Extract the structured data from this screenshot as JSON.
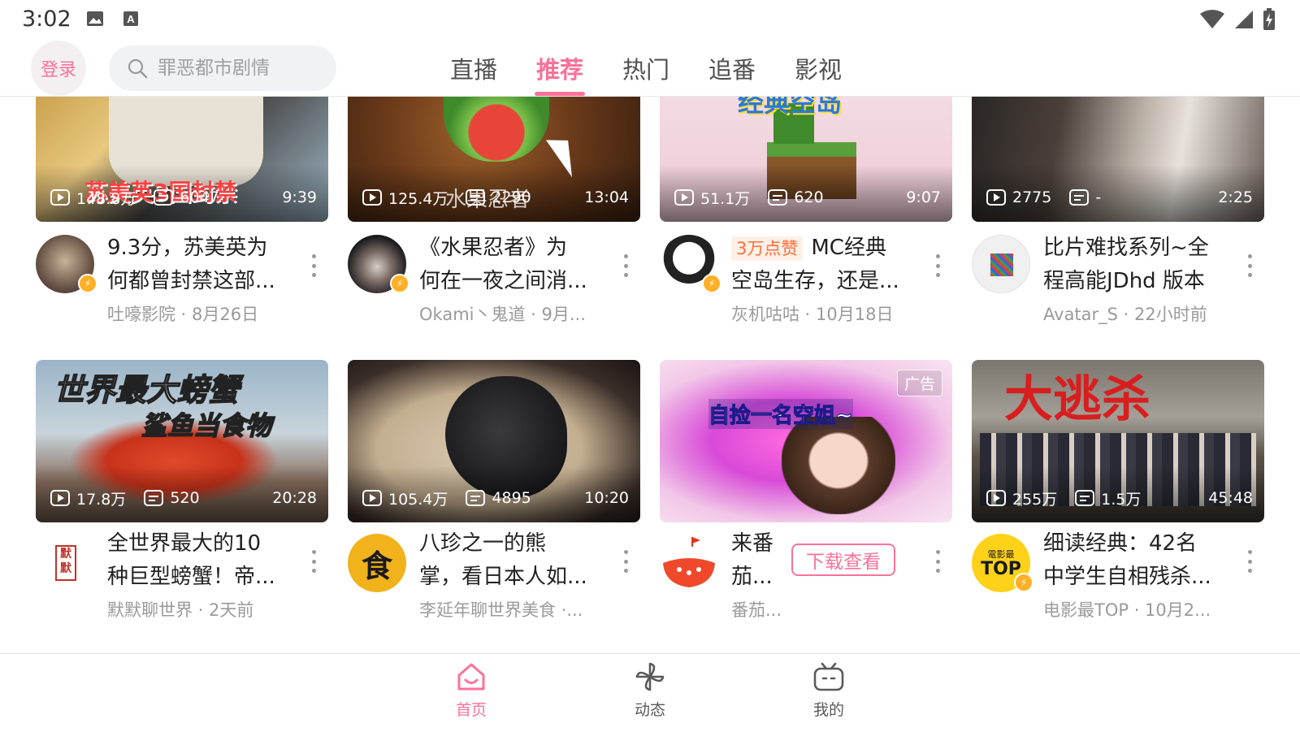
{
  "status_bar": {
    "time": "3:02",
    "icons": [
      "image-icon",
      "keyboard-a-icon",
      "wifi-icon",
      "signal-icon",
      "battery-charging-icon"
    ]
  },
  "header": {
    "login_label": "登录",
    "search_placeholder": "罪恶都市剧情",
    "tabs": [
      "直播",
      "推荐",
      "热门",
      "追番",
      "影视"
    ],
    "active_tab": "推荐"
  },
  "colors": {
    "accent": "#fb7299",
    "tag_orange": "#ff6e3a",
    "verified_badge": "#ffb027"
  },
  "feed": {
    "row1": [
      {
        "views": "148.8万",
        "danmaku": "6047",
        "duration": "9:39",
        "title_line1": "9.3分，苏美英为",
        "title_line2": "何都曾封禁这部...",
        "meta": "吐嚎影院 · 8月26日",
        "thumb_text": "苏美英3国封禁"
      },
      {
        "views": "125.4万",
        "danmaku": "2290",
        "duration": "13:04",
        "title_line1": "《水果忍者》为",
        "title_line2": "何在一夜之间消...",
        "meta": "Okami丶鬼道 · 9月...",
        "thumb_text": "水果忍者"
      },
      {
        "views": "51.1万",
        "danmaku": "620",
        "duration": "9:07",
        "tag": "3万点赞",
        "title_line1": "MC经典",
        "title_line2": "空岛生存，还是...",
        "meta": "灰机咕咕 · 10月18日",
        "thumb_text": "经典空岛"
      },
      {
        "views": "2775",
        "danmaku": "-",
        "duration": "2:25",
        "title_line1": "比片难找系列~全",
        "title_line2": "程高能JDhd 版本",
        "meta": "Avatar_S · 22小时前"
      }
    ],
    "row2": [
      {
        "views": "17.8万",
        "danmaku": "520",
        "duration": "20:28",
        "title_line1": "全世界最大的10",
        "title_line2": "种巨型螃蟹！帝...",
        "meta": "默默聊世界 · 2天前",
        "thumb_line1": "世界最大螃蟹",
        "thumb_line2": "鲨鱼当食物",
        "avatar_text": "默默"
      },
      {
        "views": "105.4万",
        "danmaku": "4895",
        "duration": "10:20",
        "title_line1": "八珍之一的熊",
        "title_line2": "掌，看日本人如...",
        "meta": "李延年聊世界美食 ·...",
        "avatar_text": "食"
      },
      {
        "ad_label": "广告",
        "thumb_text": "自捡一名空姐~",
        "title_line1": "来番",
        "title_line2": "茄...",
        "download_label": "下载查看",
        "meta": "番茄..."
      },
      {
        "views": "255万",
        "danmaku": "1.5万",
        "duration": "45:48",
        "title_line1": "细读经典：42名",
        "title_line2": "中学生自相残杀...",
        "meta": "电影最TOP · 10月2...",
        "thumb_text": "大逃杀",
        "avatar_line1": "電影最",
        "avatar_line2": "TOP"
      }
    ]
  },
  "bottom_nav": [
    {
      "label": "首页",
      "icon": "home-icon",
      "active": true
    },
    {
      "label": "动态",
      "icon": "pinwheel-icon",
      "active": false
    },
    {
      "label": "我的",
      "icon": "tv-mine-icon",
      "active": false
    }
  ]
}
